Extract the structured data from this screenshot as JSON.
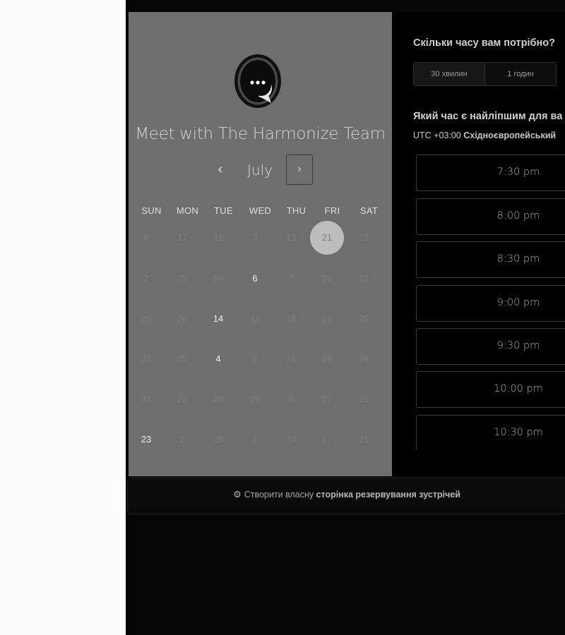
{
  "booking": {
    "team_name": "Meet with The Harmonize Team",
    "month": "July",
    "weekdays": [
      "SUN",
      "MON",
      "TUE",
      "WED",
      "THU",
      "FRI",
      "SAT"
    ],
    "calendar_rows": [
      [
        {
          "d": "6",
          "active": false
        },
        {
          "d": "17",
          "active": false
        },
        {
          "d": "11",
          "active": false
        },
        {
          "d": "3",
          "active": false
        },
        {
          "d": "13",
          "active": false
        },
        {
          "d": "21",
          "active": true,
          "selected": true
        },
        {
          "d": "25",
          "active": false
        }
      ],
      [
        {
          "d": "2",
          "active": false
        },
        {
          "d": "25",
          "active": false
        },
        {
          "d": "18",
          "active": false
        },
        {
          "d": "6",
          "active": true
        },
        {
          "d": "7",
          "active": false
        },
        {
          "d": "26",
          "active": false
        },
        {
          "d": "12",
          "active": false
        }
      ],
      [
        {
          "d": "20",
          "active": false
        },
        {
          "d": "28",
          "active": false
        },
        {
          "d": "14",
          "active": true
        },
        {
          "d": "11",
          "active": false
        },
        {
          "d": "18",
          "active": false
        },
        {
          "d": "13",
          "active": false
        },
        {
          "d": "25",
          "active": false
        }
      ],
      [
        {
          "d": "21",
          "active": false
        },
        {
          "d": "25",
          "active": false
        },
        {
          "d": "4",
          "active": true
        },
        {
          "d": "8",
          "active": false
        },
        {
          "d": "24",
          "active": false
        },
        {
          "d": "28",
          "active": false
        },
        {
          "d": "29",
          "active": false
        }
      ],
      [
        {
          "d": "31",
          "active": false
        },
        {
          "d": "22",
          "active": false
        },
        {
          "d": "28",
          "active": false
        },
        {
          "d": "25",
          "active": false
        },
        {
          "d": "5",
          "active": false
        },
        {
          "d": "27",
          "active": false
        },
        {
          "d": "15",
          "active": false
        }
      ],
      [
        {
          "d": "23",
          "active": true
        },
        {
          "d": "2",
          "active": false
        },
        {
          "d": "28",
          "active": false
        },
        {
          "d": "1",
          "active": false
        },
        {
          "d": "24",
          "active": false
        },
        {
          "d": "17",
          "active": false
        },
        {
          "d": "21",
          "active": false
        }
      ]
    ]
  },
  "duration": {
    "question": "Скільки часу вам потрібно?",
    "options": [
      "30 хвилин",
      "1 годин"
    ],
    "selected_index": 0
  },
  "time": {
    "question": "Який час є найліпшим для ва",
    "tz_offset": "UTC +03:00",
    "tz_name": "Східноєвропейський",
    "slots": [
      "7:30 pm",
      "8:00 pm",
      "8:30 pm",
      "9:00 pm",
      "9:30 pm",
      "10:00 pm",
      "10:30 pm"
    ]
  },
  "footer": {
    "prefix": "Створити власну",
    "strong": "сторінка резервування зустрічей"
  },
  "colors": {
    "calendar_panel": "#6e6e6e",
    "dark_background": "#000000",
    "selected_day": "#bdbdbd"
  }
}
